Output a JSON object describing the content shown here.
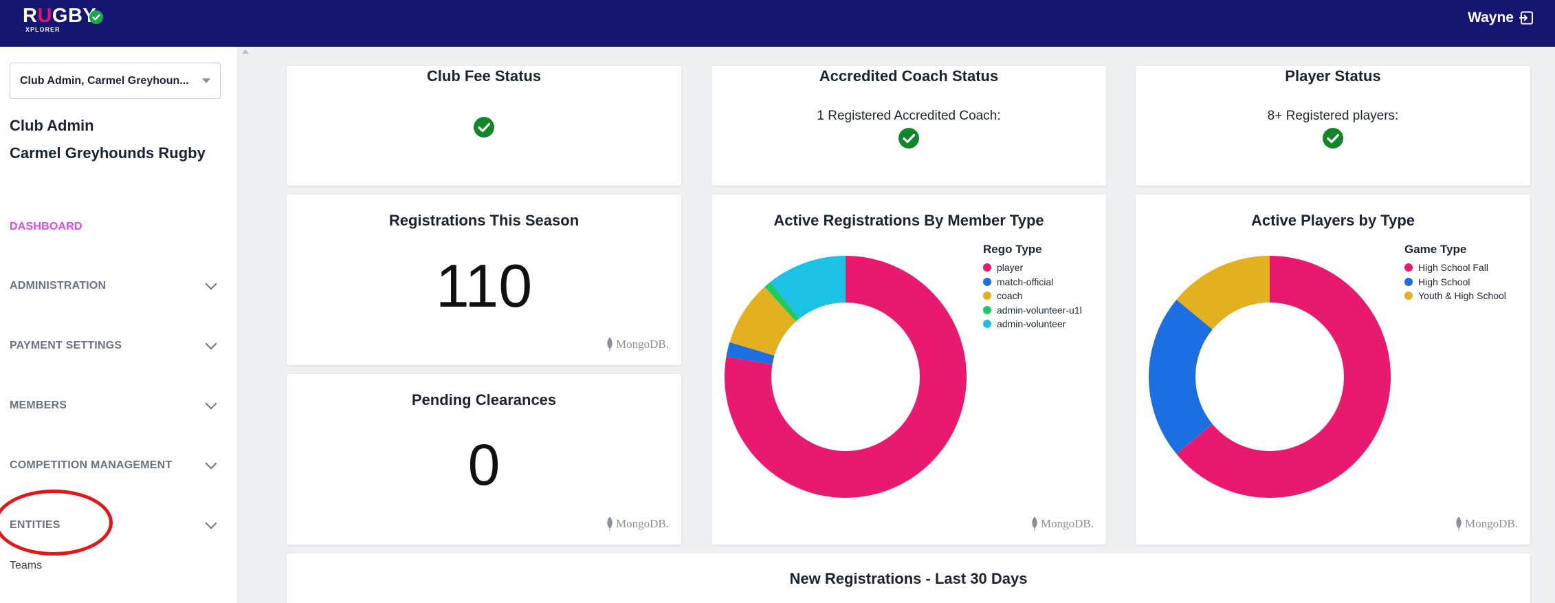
{
  "header": {
    "logo_main_prefix": "R",
    "logo_main_accent": "U",
    "logo_main_suffix": "GBY",
    "logo_sub": "XPLORER",
    "user_name": "Wayne"
  },
  "sidebar": {
    "org_select_value": "Club Admin, Carmel Greyhoun...",
    "role": "Club Admin",
    "org_name": "Carmel Greyhounds Rugby",
    "items": [
      {
        "label": "DASHBOARD"
      },
      {
        "label": "ADMINISTRATION"
      },
      {
        "label": "PAYMENT SETTINGS"
      },
      {
        "label": "MEMBERS"
      },
      {
        "label": "COMPETITION MANAGEMENT"
      },
      {
        "label": "ENTITIES"
      }
    ],
    "sub_item": "Teams"
  },
  "cards": {
    "club_fee": {
      "title": "Club Fee Status"
    },
    "coach": {
      "title": "Accredited Coach Status",
      "text": "1 Registered Accredited Coach:"
    },
    "player": {
      "title": "Player Status",
      "text": "8+ Registered players:"
    },
    "registrations": {
      "title": "Registrations This Season",
      "value": "110"
    },
    "clearances": {
      "title": "Pending Clearances",
      "value": "0"
    },
    "new_regs": {
      "title": "New Registrations - Last 30 Days"
    },
    "mongo_label": "MongoDB."
  },
  "colors": {
    "header_bg": "#141672",
    "active_nav": "#d64bf0",
    "check_green": "#12862b",
    "pink": "#e8196f",
    "blue": "#1b6fe0",
    "yellow": "#e3b020",
    "green": "#1dcb5f",
    "cyan": "#1bc2e6"
  },
  "chart_data": [
    {
      "type": "pie",
      "title": "Active Registrations By Member Type",
      "legend_title": "Rego Type",
      "legend_position": "top-right",
      "categories": [
        "player",
        "match-official",
        "coach",
        "admin-volunteer-u1l",
        "admin-volunteer"
      ],
      "values": [
        80,
        2,
        9,
        1,
        11
      ],
      "colors": [
        "#e8196f",
        "#1b6fe0",
        "#e3b020",
        "#1dcb5f",
        "#1bc2e6"
      ]
    },
    {
      "type": "pie",
      "title": "Active Players by Type",
      "legend_title": "Game Type",
      "legend_position": "top-right",
      "categories": [
        "High School Fall",
        "High School",
        "Youth & High School"
      ],
      "values": [
        64,
        22,
        14
      ],
      "colors": [
        "#e8196f",
        "#1b6fe0",
        "#e3b020"
      ]
    }
  ]
}
